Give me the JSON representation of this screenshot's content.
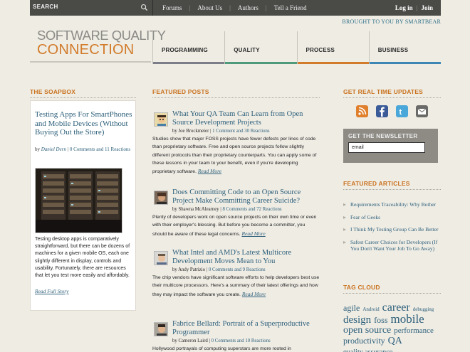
{
  "topbar": {
    "search_label": "SEARCH",
    "nav": [
      "Forums",
      "About Us",
      "Authors",
      "Tell a Friend"
    ],
    "login": "Log in",
    "join": "Join"
  },
  "brought_by": "BROUGHT TO YOU BY SMARTBEAR",
  "logo": {
    "line1": "SOFTWARE QUALITY",
    "line2": "CONNECTION"
  },
  "categories": [
    {
      "label": "PROGRAMMING",
      "color": "#7b7e88"
    },
    {
      "label": "QUALITY",
      "color": "#4f9a7a"
    },
    {
      "label": "PROCESS",
      "color": "#d27b2a"
    },
    {
      "label": "BUSINESS",
      "color": "#3e87b5"
    }
  ],
  "headings": {
    "soapbox": "THE SOAPBOX",
    "featured_posts": "FEATURED POSTS",
    "realtime": "GET REAL TIME UPDATES",
    "featured_articles": "FEATURED ARTICLES",
    "tag_cloud": "TAG CLOUD"
  },
  "soapbox": {
    "title": "Testing Apps For SmartPhones and Mobile Devices (Without Buying Out the Store)",
    "by": "by",
    "author": "Daniel Dern",
    "comments": "0 Comments and 11 Reactions",
    "text": "Testing desktop apps is comparatively straightforward, but there can be dozens of machines for a given mobile OS, each one slightly different in display, controls and usability. Fortunately, there are resources that let you test more easily and affordably.",
    "read_full": "Read Full Story"
  },
  "posts": [
    {
      "title": "What Your QA Team Can Learn from Open Source Development Projects",
      "author": "Joe Brockmeier",
      "stats": "1 Comment and 30 Reactions",
      "body": "Studies show that major FOSS projects have fewer defects per lines of code than proprietary software. Free and open source projects follow slightly different protocols than their proprietary counterparts. You can apply some of these lessons in your team to your benefit, even if you're developing proprietary software.",
      "more": "Read More"
    },
    {
      "title": "Does Committing Code to an Open Source Project Make Committing Career Suicide?",
      "author": "Shawna McAlearney",
      "stats": "8 Comments and 72 Reactions",
      "body": "Plenty of developers work on open source projects on their own time or even with their employer's blessing. But before you become a committer, you should be aware of these legal concerns.",
      "more": "Read More"
    },
    {
      "title": "What Intel and AMD's Latest Multicore Development Moves Mean to You",
      "author": "Andy Patrizio",
      "stats": "0 Comments and 9 Reactions",
      "body": "The chip vendors have significant software efforts to help developers best use their multicore processors. Here's a summary of their latest offerings and how they may impact the software you create.",
      "more": "Read More"
    },
    {
      "title": "Fabrice Bellard: Portrait of a Superproductive Programmer",
      "author": "Cameron Laird",
      "stats": "0 Comments and 10 Reactions",
      "body": "Hollywood portrayals of computing superstars are more rooted in",
      "more": ""
    }
  ],
  "byline_prefix": "by",
  "newsletter": {
    "title": "GET THE NEWSLETTER",
    "value": "email"
  },
  "featured_articles": [
    "Requirements Traceability: Why Bother",
    "Fear of Geeks",
    "I Think My Testing Group Can Be Better",
    "Safest Career Choices for Developers (If You Don't Want Your Job To Go Away)"
  ],
  "tags": [
    {
      "text": "agile",
      "size": 12
    },
    {
      "text": "Android",
      "size": 7
    },
    {
      "text": "career",
      "size": 16
    },
    {
      "text": "debugging",
      "size": 7
    },
    {
      "text": "design",
      "size": 15
    },
    {
      "text": "foss",
      "size": 12
    },
    {
      "text": "mobile",
      "size": 17
    },
    {
      "text": "open source",
      "size": 14
    },
    {
      "text": "performance",
      "size": 11
    },
    {
      "text": "productivity",
      "size": 12
    },
    {
      "text": "QA",
      "size": 14
    },
    {
      "text": "quality assurance",
      "size": 10
    }
  ],
  "colors": {
    "accent": "#c9731f",
    "link": "#2c5f7a",
    "topbar": "#4a4a47"
  },
  "social_icons": [
    "rss-icon",
    "facebook-icon",
    "twitter-icon",
    "email-icon"
  ]
}
